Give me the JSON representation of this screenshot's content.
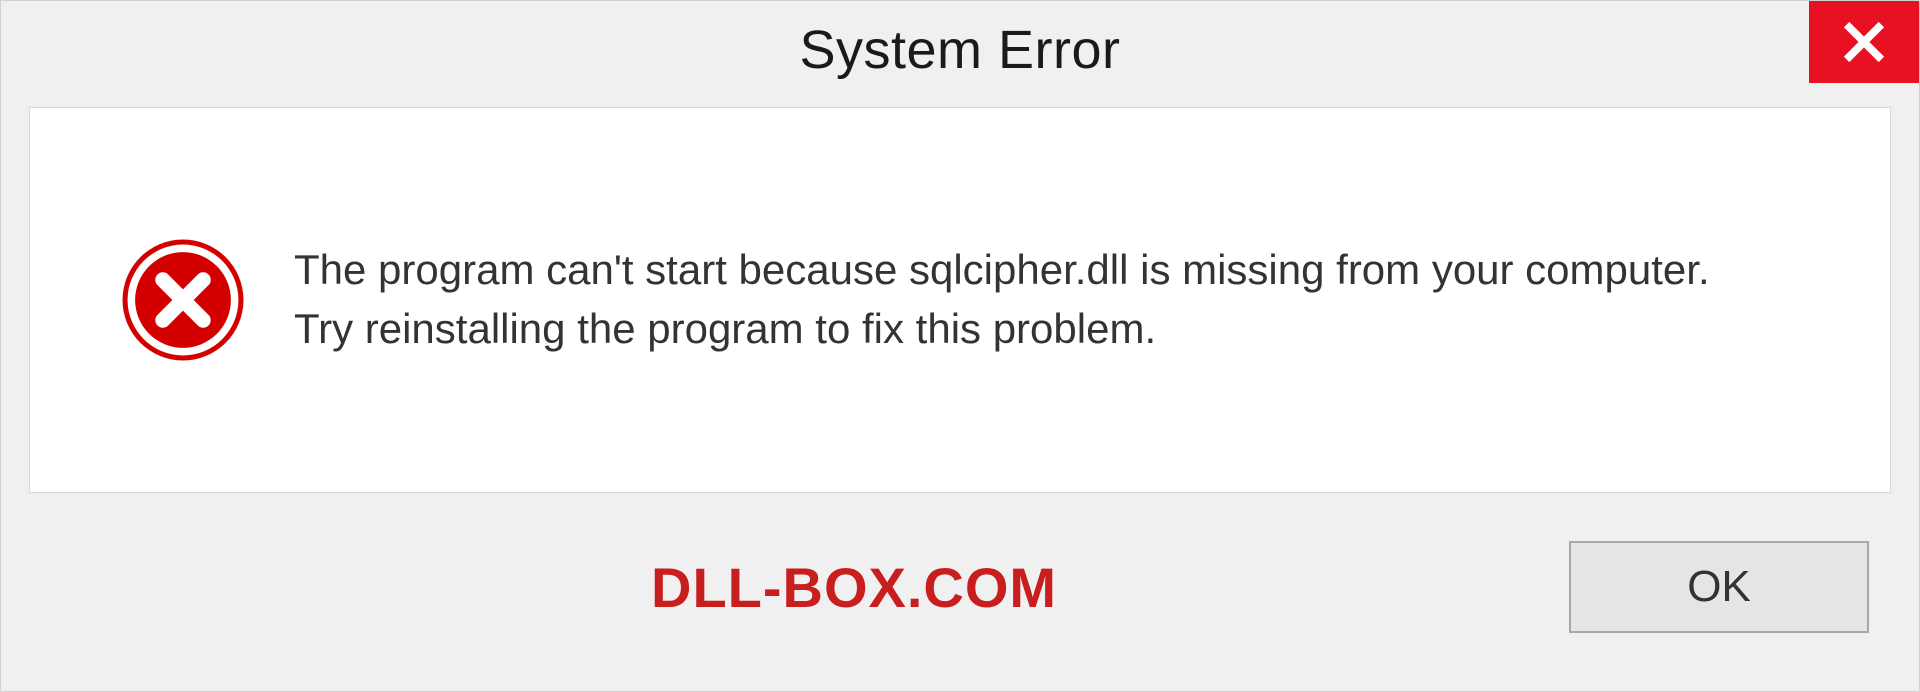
{
  "dialog": {
    "title": "System Error",
    "message": "The program can't start because sqlcipher.dll is missing from your computer. Try reinstalling the program to fix this problem.",
    "ok_label": "OK"
  },
  "watermark": "DLL-BOX.COM",
  "icons": {
    "close": "close-icon",
    "error": "error-circle-x-icon"
  },
  "colors": {
    "close_bg": "#e81123",
    "error_red": "#d40000",
    "watermark": "#c81e1e"
  }
}
